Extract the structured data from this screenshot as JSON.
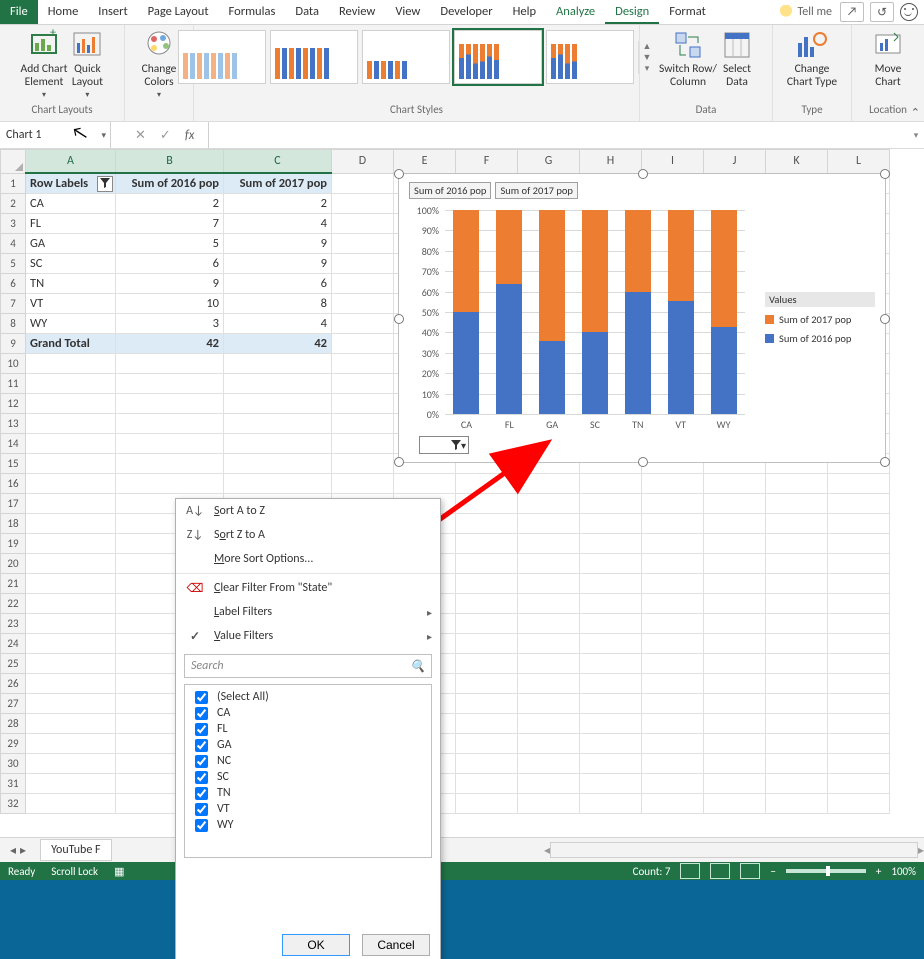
{
  "tabs": {
    "file": "File",
    "home": "Home",
    "insert": "Insert",
    "pagelayout": "Page Layout",
    "formulas": "Formulas",
    "data": "Data",
    "review": "Review",
    "view": "View",
    "developer": "Developer",
    "help": "Help",
    "analyze": "Analyze",
    "design": "Design",
    "format": "Format",
    "tellme": "Tell me"
  },
  "ribbon": {
    "addChart": "Add Chart\nElement",
    "quick": "Quick\nLayout",
    "changeColors": "Change\nColors",
    "switch": "Switch Row/\nColumn",
    "selectData": "Select\nData",
    "changeType": "Change\nChart Type",
    "move": "Move\nChart",
    "grp_layouts": "Chart Layouts",
    "grp_styles": "Chart Styles",
    "grp_data": "Data",
    "grp_type": "Type",
    "grp_loc": "Location"
  },
  "namebox": "Chart 1",
  "pivot": {
    "headers": [
      "Row Labels",
      "Sum of 2016 pop",
      "Sum of 2017 pop"
    ],
    "rows": [
      {
        "label": "CA",
        "a": "2",
        "b": "2"
      },
      {
        "label": "FL",
        "a": "7",
        "b": "4"
      },
      {
        "label": "GA",
        "a": "5",
        "b": "9"
      },
      {
        "label": "SC",
        "a": "6",
        "b": "9"
      },
      {
        "label": "TN",
        "a": "9",
        "b": "6"
      },
      {
        "label": "VT",
        "a": "10",
        "b": "8"
      },
      {
        "label": "WY",
        "a": "3",
        "b": "4"
      }
    ],
    "totalLabel": "Grand Total",
    "totA": "42",
    "totB": "42"
  },
  "chart_data": {
    "type": "bar",
    "stacked_pct": true,
    "categories": [
      "CA",
      "FL",
      "GA",
      "SC",
      "TN",
      "VT",
      "WY"
    ],
    "series": [
      {
        "name": "Sum of 2016 pop",
        "values": [
          2,
          7,
          5,
          6,
          9,
          10,
          3
        ],
        "color": "#4472c4"
      },
      {
        "name": "Sum of 2017 pop",
        "values": [
          2,
          4,
          9,
          9,
          6,
          8,
          4
        ],
        "color": "#ed7d31"
      }
    ],
    "yticks": [
      "0%",
      "10%",
      "20%",
      "30%",
      "40%",
      "50%",
      "60%",
      "70%",
      "80%",
      "90%",
      "100%"
    ],
    "legend_title": "Values",
    "field_buttons": [
      "Sum of 2016 pop",
      "Sum of 2017 pop"
    ]
  },
  "filter": {
    "sortAZ": "Sort A to Z",
    "sortZA": "Sort Z to A",
    "moreSort": "More Sort Options...",
    "clear": "Clear Filter From \"State\"",
    "labelFilters": "Label Filters",
    "valueFilters": "Value Filters",
    "search": "Search",
    "items": [
      "(Select All)",
      "CA",
      "FL",
      "GA",
      "NC",
      "SC",
      "TN",
      "VT",
      "WY"
    ],
    "ok": "OK",
    "cancel": "Cancel"
  },
  "sheettab": "YouTube F",
  "status": {
    "ready": "Ready",
    "scroll": "Scroll Lock",
    "count": "Count: 7",
    "zoom": "100%"
  },
  "columns": [
    "A",
    "B",
    "C",
    "D",
    "E",
    "F",
    "G",
    "H",
    "I",
    "J",
    "K",
    "L"
  ]
}
